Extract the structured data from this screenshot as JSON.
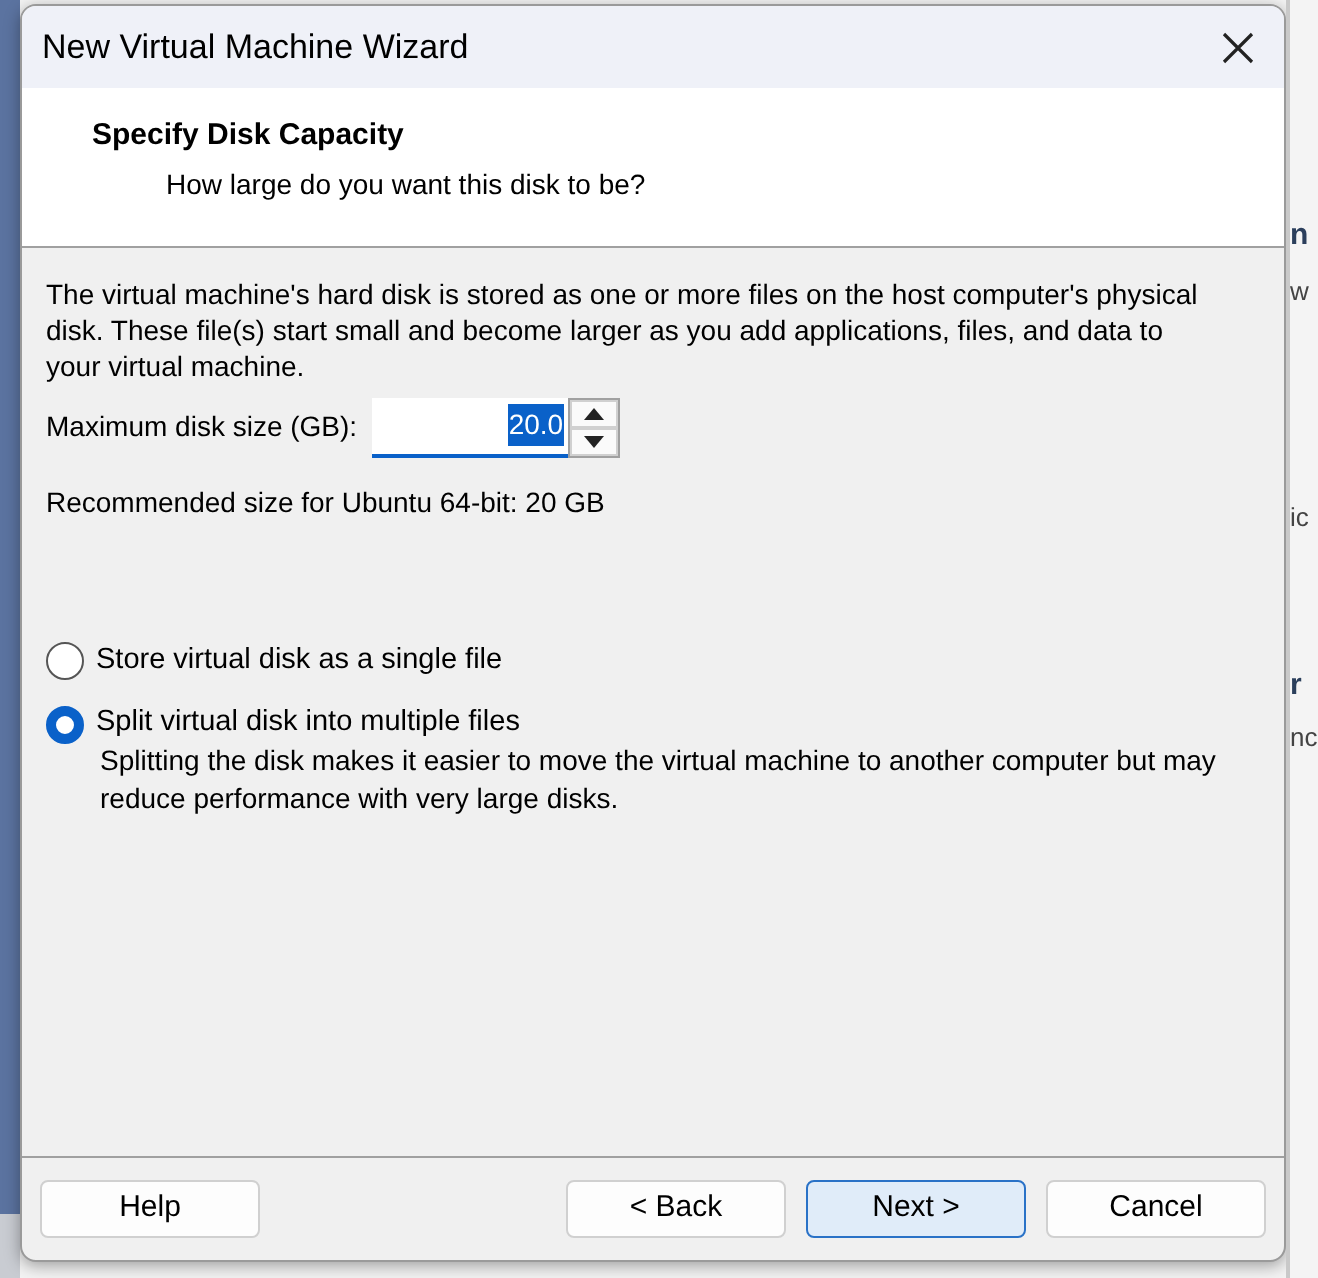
{
  "window": {
    "title": "New Virtual Machine Wizard"
  },
  "header": {
    "title": "Specify Disk Capacity",
    "subtitle": "How large do you want this disk to be?"
  },
  "intro": "The virtual machine's hard disk is stored as one or more files on the host computer's physical disk. These file(s) start small and become larger as you add applications, files, and data to your virtual machine.",
  "disk_size": {
    "label": "Maximum disk size (GB):",
    "value": "20.0",
    "selected_text": true
  },
  "recommended": "Recommended size for Ubuntu 64-bit: 20 GB",
  "options": [
    {
      "label": "Store virtual disk as a single file",
      "selected": false
    },
    {
      "label": "Split virtual disk into multiple files",
      "selected": true,
      "description": "Splitting the disk makes it easier to move the virtual machine to another computer but may reduce performance with very large disks."
    }
  ],
  "buttons": [
    {
      "label": "Help",
      "default": false,
      "kind": "help"
    },
    {
      "label": "< Back",
      "default": false,
      "kind": "nav"
    },
    {
      "label": "Next >",
      "default": true,
      "kind": "nav"
    },
    {
      "label": "Cancel",
      "default": false,
      "kind": "nav"
    }
  ],
  "background_fragments": [
    {
      "text": "n",
      "bold": true
    },
    {
      "text": "w",
      "bold": false
    },
    {
      "text": "ic",
      "bold": false
    },
    {
      "text": "r",
      "bold": true
    },
    {
      "text": "nc",
      "bold": false
    }
  ]
}
